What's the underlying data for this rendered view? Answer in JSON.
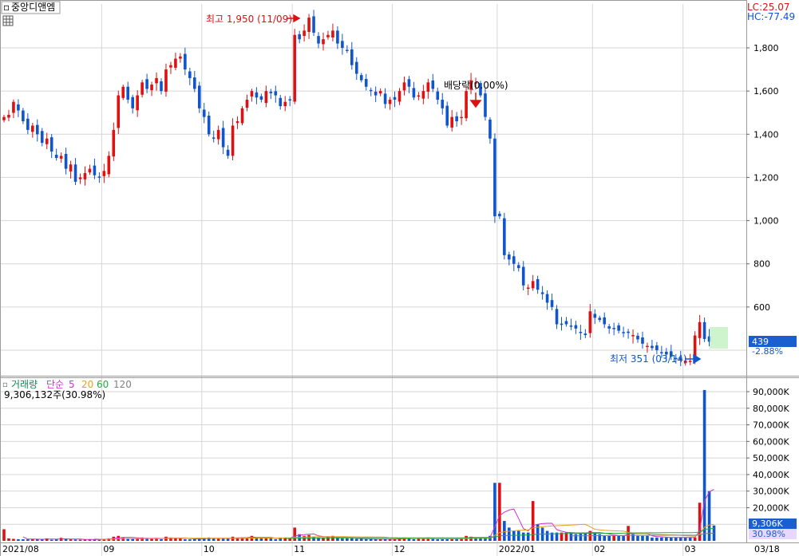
{
  "header": {
    "stock_name": "중앙디앤엠",
    "lc_label": "LC:25.07",
    "hc_label": "HC:-77.49"
  },
  "price_panel": {
    "high_annotation": "최고 1,950 (11/09)",
    "low_annotation": "최저 351 (03/14)",
    "ex_dividend_annotation": "배당락(0.00%)",
    "current_price_tag": "439",
    "current_change_tag": "-2.88%"
  },
  "volume_panel": {
    "title": "거래량",
    "ma_label": "단순",
    "ma_periods": [
      "5",
      "20",
      "60",
      "120"
    ],
    "current_value_text": "9,306,132주(30.98%)",
    "current_volume_tag": "9,306K",
    "current_ratio_tag": "30.98%"
  },
  "x_axis": {
    "ticks": [
      {
        "label": "2021/08",
        "i": 0
      },
      {
        "label": "09",
        "i": 21
      },
      {
        "label": "10",
        "i": 42
      },
      {
        "label": "11",
        "i": 61
      },
      {
        "label": "12",
        "i": 82
      },
      {
        "label": "2022/01",
        "i": 104
      },
      {
        "label": "02",
        "i": 124
      },
      {
        "label": "03",
        "i": 143
      }
    ],
    "end_label": "03/18"
  },
  "colors": {
    "up": "#dd1111",
    "down": "#1155cc",
    "grid": "#d6d6d6",
    "ma5": "#cc33cc",
    "ma20": "#e6a020",
    "ma60": "#22aa44",
    "ma120": "#808080",
    "tag_bg": "#1a5fd0"
  },
  "chart_data": [
    {
      "type": "candlestick",
      "title": "중앙디앤엠",
      "y_axis": {
        "ticks": [
          1800,
          1600,
          1400,
          1200,
          1000,
          800,
          600
        ],
        "tick_labels": [
          "1,800",
          "1,600",
          "1,400",
          "1,200",
          "1,000",
          "800",
          "600"
        ],
        "range": [
          400,
          1960
        ]
      },
      "high": {
        "value": 1950,
        "date": "11/09"
      },
      "low": {
        "value": 351,
        "date": "03/14"
      },
      "last_close": 439,
      "change_pct": -2.88,
      "close": [
        1480,
        1490,
        1550,
        1510,
        1460,
        1420,
        1440,
        1400,
        1360,
        1380,
        1320,
        1290,
        1300,
        1240,
        1260,
        1180,
        1200,
        1220,
        1240,
        1210,
        1200,
        1230,
        1300,
        1420,
        1580,
        1620,
        1560,
        1520,
        1580,
        1640,
        1610,
        1630,
        1660,
        1600,
        1700,
        1720,
        1750,
        1760,
        1700,
        1660,
        1610,
        1520,
        1480,
        1400,
        1380,
        1420,
        1340,
        1300,
        1440,
        1460,
        1520,
        1560,
        1600,
        1570,
        1560,
        1600,
        1590,
        1580,
        1530,
        1550,
        1560,
        1860,
        1840,
        1880,
        1940,
        1870,
        1820,
        1840,
        1860,
        1880,
        1820,
        1800,
        1790,
        1720,
        1680,
        1650,
        1620,
        1600,
        1580,
        1600,
        1540,
        1560,
        1560,
        1600,
        1640,
        1620,
        1570,
        1580,
        1600,
        1640,
        1610,
        1560,
        1520,
        1440,
        1480,
        1460,
        1480,
        1600,
        1650,
        1640,
        1580,
        1480,
        1380,
        1020,
        1020,
        840,
        820,
        800,
        780,
        700,
        690,
        720,
        680,
        660,
        620,
        600,
        520,
        520,
        520,
        510,
        500,
        480,
        470,
        580,
        550,
        540,
        520,
        500,
        500,
        490,
        480,
        480,
        470,
        450,
        430,
        420,
        410,
        400,
        390,
        380,
        370,
        360,
        355,
        352,
        351,
        468,
        530,
        452,
        439
      ],
      "note_y": "Closing prices (KRW) estimated from the chart, one value per trading day from 2021/08 to 03/18"
    },
    {
      "type": "bar",
      "title": "거래량",
      "y_axis": {
        "ticks": [
          90000,
          80000,
          70000,
          60000,
          50000,
          40000,
          30000,
          20000
        ],
        "tick_labels": [
          "90,000K",
          "80,000K",
          "70,000K",
          "60,000K",
          "50,000K",
          "40,000K",
          "30,000K",
          "20,000K"
        ],
        "range": [
          0,
          94000
        ],
        "unit": "K"
      },
      "last_volume": 9306132,
      "last_ratio_pct": 30.98,
      "values": [
        7000,
        1500,
        1200,
        1000,
        1000,
        900,
        1200,
        1000,
        800,
        1500,
        700,
        1000,
        1800,
        1000,
        900,
        800,
        700,
        800,
        1000,
        900,
        800,
        1200,
        1500,
        2500,
        3000,
        2000,
        1500,
        1200,
        1500,
        2000,
        1500,
        1200,
        1400,
        1000,
        2500,
        2000,
        1500,
        1500,
        1000,
        900,
        1200,
        1400,
        1800,
        2000,
        1500,
        1200,
        1400,
        1600,
        2500,
        2000,
        2000,
        1500,
        3000,
        2000,
        1500,
        2000,
        1500,
        1000,
        2000,
        2000,
        1500,
        8000,
        4000,
        3000,
        3500,
        2500,
        2000,
        2000,
        2500,
        3000,
        2000,
        1500,
        1500,
        1500,
        1200,
        1200,
        1000,
        1000,
        1000,
        1200,
        1000,
        1000,
        1000,
        1500,
        2000,
        1500,
        1000,
        1200,
        1500,
        2000,
        1500,
        1000,
        1000,
        1200,
        1500,
        1500,
        1500,
        3000,
        2500,
        1500,
        1500,
        1500,
        3000,
        35000,
        35000,
        12000,
        8000,
        6000,
        6000,
        5000,
        5000,
        24000,
        10000,
        8000,
        6000,
        5000,
        5000,
        5000,
        5000,
        5000,
        4000,
        5000,
        5000,
        6000,
        5000,
        4000,
        3000,
        3000,
        3000,
        3000,
        3000,
        9000,
        4000,
        3000,
        3000,
        3000,
        2000,
        2000,
        2000,
        2000,
        2000,
        2000,
        2000,
        2000,
        2000,
        2000,
        23000,
        91000,
        30000,
        9306
      ]
    }
  ]
}
